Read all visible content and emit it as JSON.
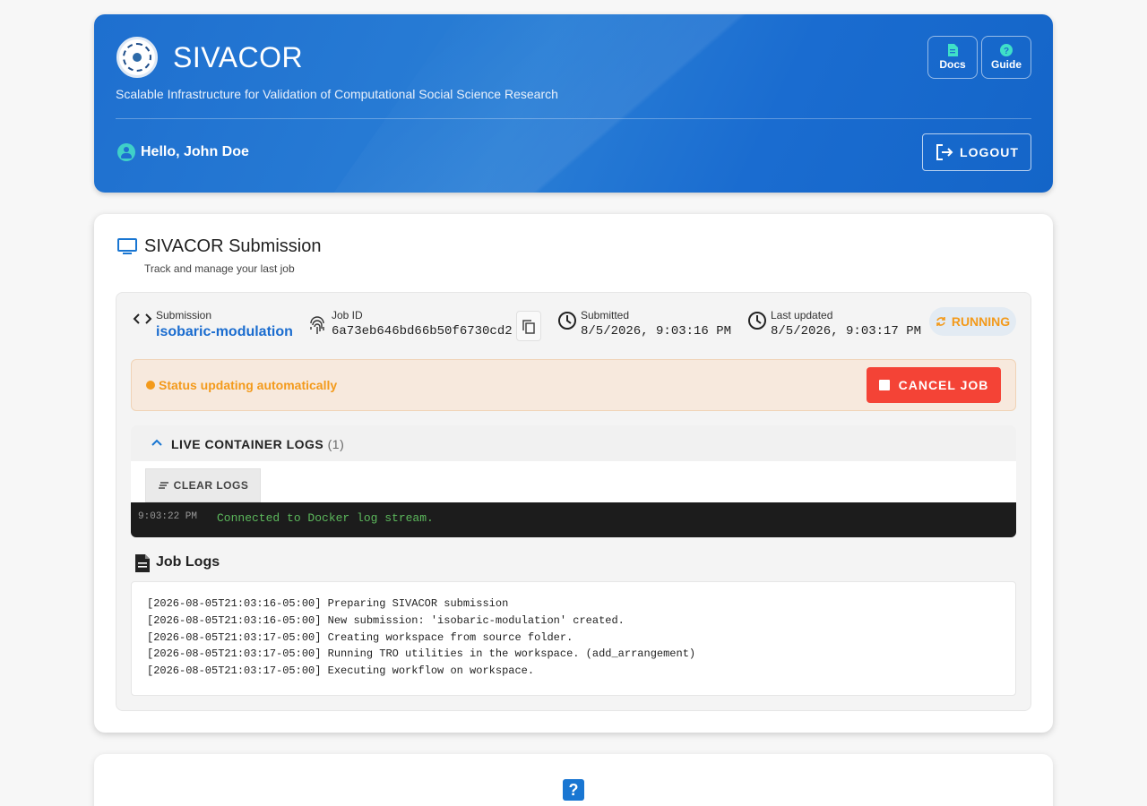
{
  "header": {
    "app_title": "SIVACOR",
    "subtitle": "Scalable Infrastructure for Validation of Computational Social Science Research",
    "docs_label": "Docs",
    "guide_label": "Guide",
    "greeting": "Hello, John Doe",
    "logout_label": "LOGOUT"
  },
  "submission_card": {
    "title": "SIVACOR Submission",
    "subtitle": "Track and manage your last job",
    "submission_label": "Submission",
    "submission_name": "isobaric-modulation",
    "job_id_label": "Job ID",
    "job_id": "6a73eb646bd66b50f6730cd2",
    "submitted_label": "Submitted",
    "submitted_value": "8/5/2026, 9:03:16 PM",
    "updated_label": "Last updated",
    "updated_value": "8/5/2026, 9:03:17 PM",
    "status_badge": "RUNNING",
    "status_message": "Status updating automatically",
    "cancel_label": "CANCEL JOB"
  },
  "live_logs": {
    "title": "LIVE CONTAINER LOGS",
    "count": "(1)",
    "clear_label": "CLEAR LOGS",
    "entries": [
      {
        "time": "9:03:22 PM",
        "message": "Connected to Docker log stream."
      }
    ]
  },
  "job_logs": {
    "title": "Job Logs",
    "lines": [
      "[2026-08-05T21:03:16-05:00] Preparing SIVACOR submission",
      "[2026-08-05T21:03:16-05:00] New submission: 'isobaric-modulation' created.",
      "[2026-08-05T21:03:17-05:00] Creating workspace from source folder.",
      "[2026-08-05T21:03:17-05:00] Running TRO utilities in the workspace. (add_arrangement)",
      "[2026-08-05T21:03:17-05:00] Executing workflow on workspace."
    ]
  },
  "colors": {
    "brand_blue": "#1e6fcf",
    "status_orange": "#f39a1b",
    "cancel_red": "#f44336",
    "log_green": "#5cb85c"
  },
  "icons": [
    "logo-icon",
    "docs-icon",
    "guide-icon",
    "user-icon",
    "logout-icon",
    "monitor-icon",
    "code-icon",
    "fingerprint-icon",
    "copy-icon",
    "clock-icon",
    "sync-icon",
    "stop-icon",
    "chevron-up-icon",
    "clear-icon",
    "document-icon",
    "help-icon"
  ]
}
